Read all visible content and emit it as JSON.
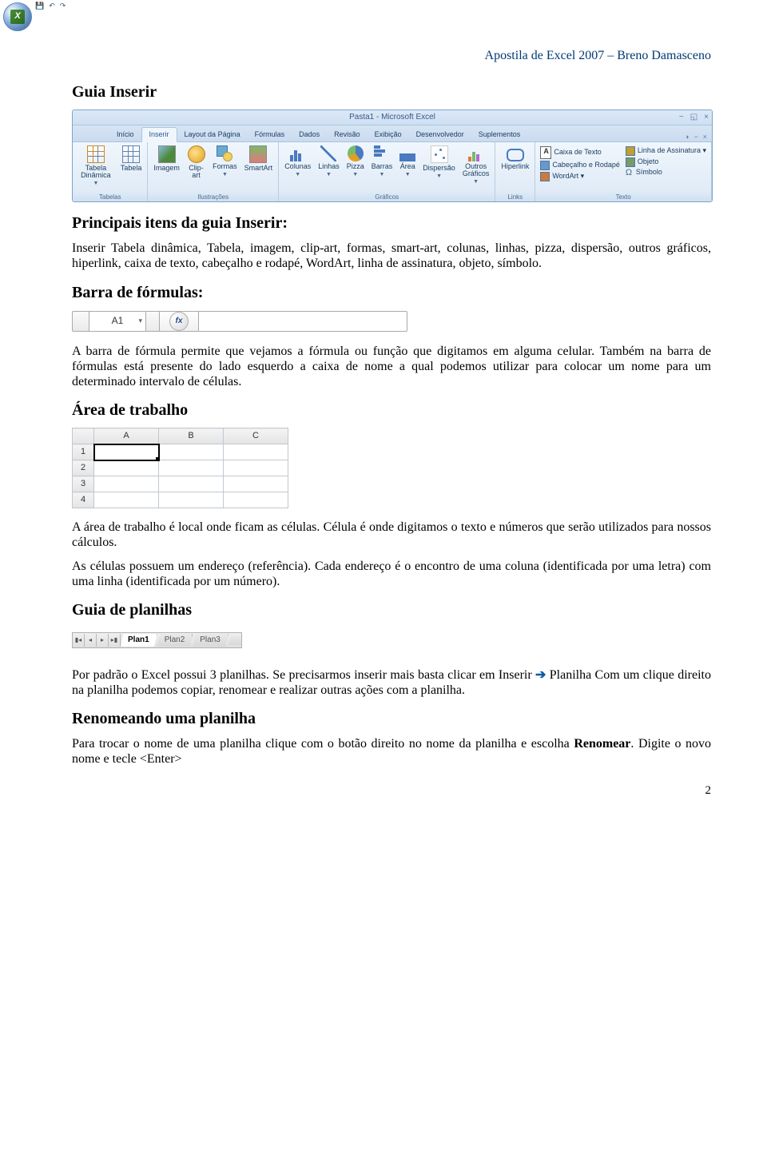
{
  "header": "Apostila de Excel 2007 – Breno Damasceno",
  "h1": "Guia Inserir",
  "ribbon": {
    "title": "Pasta1 - Microsoft Excel",
    "tabs": [
      "Início",
      "Inserir",
      "Layout da Página",
      "Fórmulas",
      "Dados",
      "Revisão",
      "Exibição",
      "Desenvolvedor",
      "Suplementos"
    ],
    "active_tab": "Inserir",
    "groups": {
      "tabelas": {
        "label": "Tabelas",
        "btns": [
          "Tabela Dinâmica ▾",
          "Tabela"
        ]
      },
      "ilustracoes": {
        "label": "Ilustrações",
        "btns": [
          "Imagem",
          "Clip-art",
          "Formas ▾",
          "SmartArt"
        ]
      },
      "graficos": {
        "label": "Gráficos",
        "btns": [
          "Colunas ▾",
          "Linhas ▾",
          "Pizza ▾",
          "Barras ▾",
          "Área ▾",
          "Dispersão ▾",
          "Outros Gráficos ▾"
        ]
      },
      "links": {
        "label": "Links",
        "btns": [
          "Hiperlink"
        ]
      },
      "texto": {
        "label": "Texto",
        "big": "Caixa de Texto",
        "rows": [
          "Cabeçalho e Rodapé",
          "WordArt ▾",
          "Linha de Assinatura ▾",
          "Objeto",
          "Símbolo"
        ]
      }
    }
  },
  "h2a": "Principais itens da guia Inserir:",
  "p1": "Inserir Tabela dinâmica, Tabela, imagem, clip-art, formas, smart-art, colunas, linhas, pizza, dispersão, outros gráficos, hiperlink, caixa de texto, cabeçalho e rodapé, WordArt, linha de assinatura, objeto, símbolo.",
  "h2b": "Barra de fórmulas:",
  "fbar": {
    "name": "A1",
    "fx": "fx"
  },
  "p2": "A barra de fórmula permite que vejamos a fórmula ou função que digitamos em alguma celular. Também na barra de fórmulas está presente do lado esquerdo a caixa de nome a qual podemos utilizar para colocar um nome para um determinado intervalo de células.",
  "h2c": "Área de trabalho",
  "sheet": {
    "cols": [
      "A",
      "B",
      "C"
    ],
    "rows": [
      "1",
      "2",
      "3",
      "4"
    ]
  },
  "p3": "A área de trabalho é local onde ficam as células. Célula é onde digitamos o texto e números que serão utilizados para nossos cálculos.",
  "p4": "As células possuem um endereço (referência). Cada endereço é o encontro de uma coluna (identificada por uma letra) com uma linha (identificada por um número).",
  "h2d": "Guia de planilhas",
  "stabs": [
    "Plan1",
    "Plan2",
    "Plan3"
  ],
  "p5a": "Por padrão o Excel possui 3 planilhas. Se precisarmos inserir mais basta clicar em Inserir ",
  "p5b": " Planilha Com um clique direito na planilha podemos copiar, renomear e realizar outras ações com a planilha.",
  "h2e": "Renomeando uma planilha",
  "p6a": "Para trocar o nome de uma planilha clique com o botão direito no nome da planilha e escolha ",
  "p6b": "Renomear",
  "p6c": ". Digite o novo nome e tecle <Enter>",
  "page": "2"
}
